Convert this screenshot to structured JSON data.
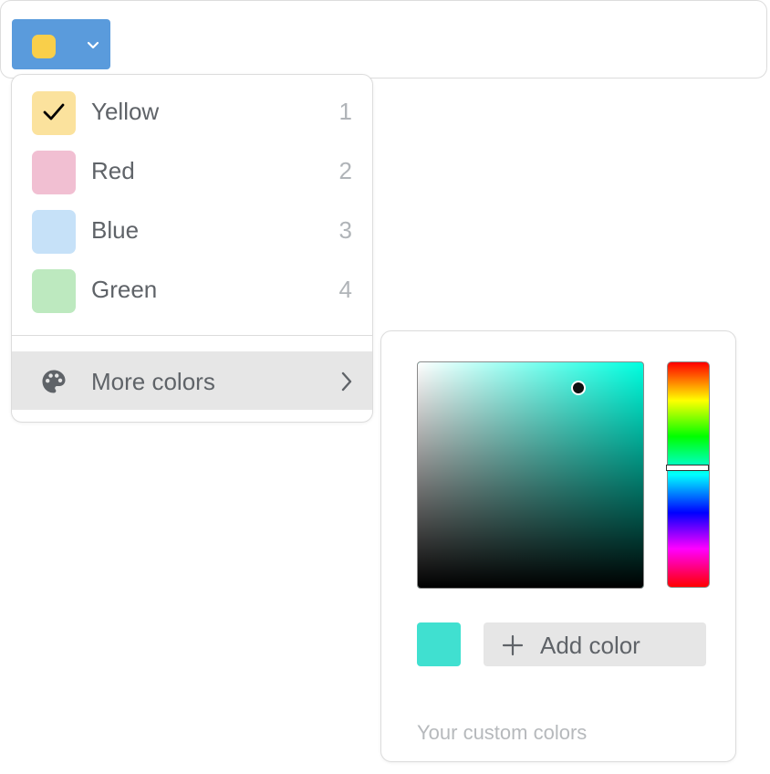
{
  "toolbar": {
    "current_color": "#f9cf4a",
    "trigger_bg": "#5a9bdc",
    "chevron_icon": "chevron-down-icon"
  },
  "menu": {
    "options": [
      {
        "label": "Yellow",
        "shortcut": "1",
        "color": "#fbe29d",
        "selected": true
      },
      {
        "label": "Red",
        "shortcut": "2",
        "color": "#f1bfd2",
        "selected": false
      },
      {
        "label": "Blue",
        "shortcut": "3",
        "color": "#c6e1f8",
        "selected": false
      },
      {
        "label": "Green",
        "shortcut": "4",
        "color": "#bde9bf",
        "selected": false
      }
    ],
    "checkmark_icon": "checkmark-icon",
    "more_label": "More colors",
    "more_icon": "palette-icon",
    "more_arrow_icon": "chevron-right-icon"
  },
  "picker": {
    "hue_color": "#00ffe0",
    "current_color": "#40e0d0",
    "add_label": "Add color",
    "add_icon": "plus-icon",
    "custom_colors_label": "Your custom colors"
  }
}
